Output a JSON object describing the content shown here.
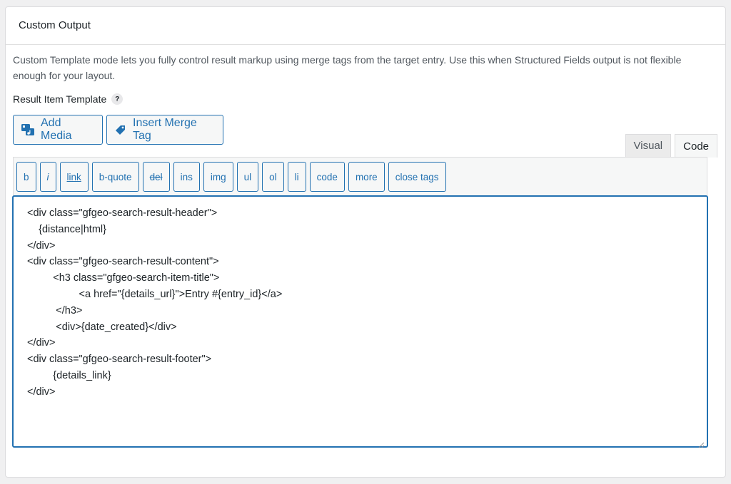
{
  "panel": {
    "title": "Custom Output",
    "description": "Custom Template mode lets you fully control result markup using merge tags from the target entry. Use this when Structured Fields output is not flexible enough for your layout."
  },
  "field": {
    "label": "Result Item Template",
    "help": "?"
  },
  "media_buttons": {
    "add_media": "Add Media",
    "insert_merge_tag": "Insert Merge Tag"
  },
  "editor_tabs": {
    "visual": "Visual",
    "code": "Code",
    "active": "Code"
  },
  "quicktags": [
    "b",
    "i",
    "link",
    "b-quote",
    "del",
    "ins",
    "img",
    "ul",
    "ol",
    "li",
    "code",
    "more",
    "close tags"
  ],
  "code_lines": [
    "<div class=\"gfgeo-search-result-header\">",
    "    {distance|html}",
    "</div>",
    "<div class=\"gfgeo-search-result-content\">",
    "         <h3 class=\"gfgeo-search-item-title\">",
    "                  <a href=\"{details_url}\">Entry #{entry_id}</a>",
    "          </h3>",
    "          <div>{date_created}</div>",
    "</div>",
    "<div class=\"gfgeo-search-result-footer\">",
    "         {details_link}",
    "</div>"
  ],
  "colors": {
    "accent": "#2271b1",
    "panel_border": "#dcdcde",
    "text": "#1d2327"
  }
}
